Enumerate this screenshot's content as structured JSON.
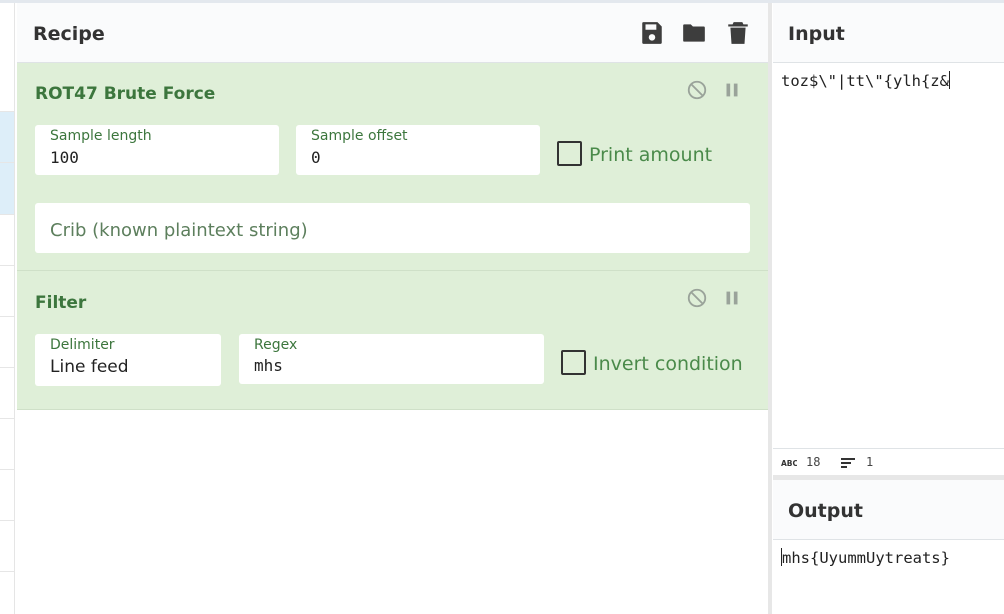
{
  "recipe": {
    "title": "Recipe",
    "header_icons": [
      "save-icon",
      "folder-icon",
      "trash-icon"
    ]
  },
  "operations": [
    {
      "title": "ROT47 Brute Force",
      "fields": {
        "sample_length": {
          "label": "Sample length",
          "value": "100"
        },
        "sample_offset": {
          "label": "Sample offset",
          "value": "0"
        },
        "crib": {
          "placeholder": "Crib (known plaintext string)"
        }
      },
      "checkbox": {
        "label": "Print amount",
        "checked": false
      }
    },
    {
      "title": "Filter",
      "fields": {
        "delimiter": {
          "label": "Delimiter",
          "value": "Line feed"
        },
        "regex": {
          "label": "Regex",
          "value": "mhs"
        }
      },
      "checkbox": {
        "label": "Invert condition",
        "checked": false
      }
    }
  ],
  "input": {
    "title": "Input",
    "text": "toz$\\\"|tt\\\"{ylh{z&",
    "status": {
      "chars": "18",
      "lines": "1"
    }
  },
  "output": {
    "title": "Output",
    "text": "mhs{UyummUytreats}"
  },
  "colors": {
    "op_background": "#dfefd8",
    "op_text": "#3c763d",
    "header_background": "#fafbfc"
  }
}
